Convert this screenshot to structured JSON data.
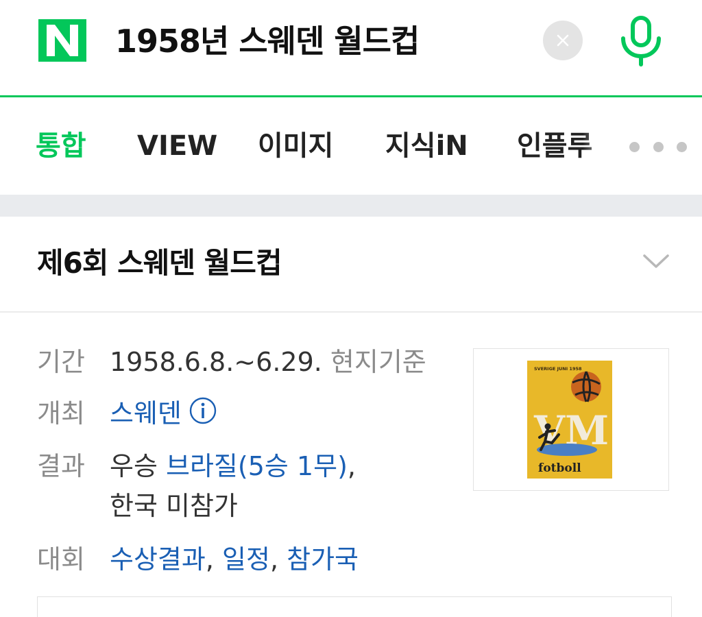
{
  "search": {
    "query": "1958년 스웨덴 월드컵"
  },
  "tabs": [
    {
      "label": "통합",
      "active": true
    },
    {
      "label": "VIEW"
    },
    {
      "label": "이미지"
    },
    {
      "label": "지식iN"
    },
    {
      "label": "인플루"
    }
  ],
  "card": {
    "title": "제6회 스웨덴 월드컵",
    "rows": {
      "period": {
        "label": "기간",
        "value": "1958.6.8.~6.29.",
        "note": "현지기준"
      },
      "host": {
        "label": "개최",
        "value": "스웨덴"
      },
      "result": {
        "label": "결과",
        "prefix": "우승",
        "winner": "브라질(5승 1무)",
        "comma": ",",
        "line2": "한국 미참가"
      },
      "tournament": {
        "label": "대회",
        "links": [
          "수상결과",
          "일정",
          "참가국"
        ],
        "sep": ", "
      }
    },
    "poster": {
      "top_text": "SVERIGE JUNI 1958",
      "big_text": "VM",
      "bottom_text": "fotboll"
    }
  },
  "colors": {
    "brand": "#03c75a",
    "link": "#1a5fb4",
    "muted": "#8b8b8b"
  },
  "icons": [
    "naver-logo-icon",
    "close-icon",
    "mic-icon",
    "more-icon",
    "chevron-down-icon",
    "info-icon"
  ]
}
